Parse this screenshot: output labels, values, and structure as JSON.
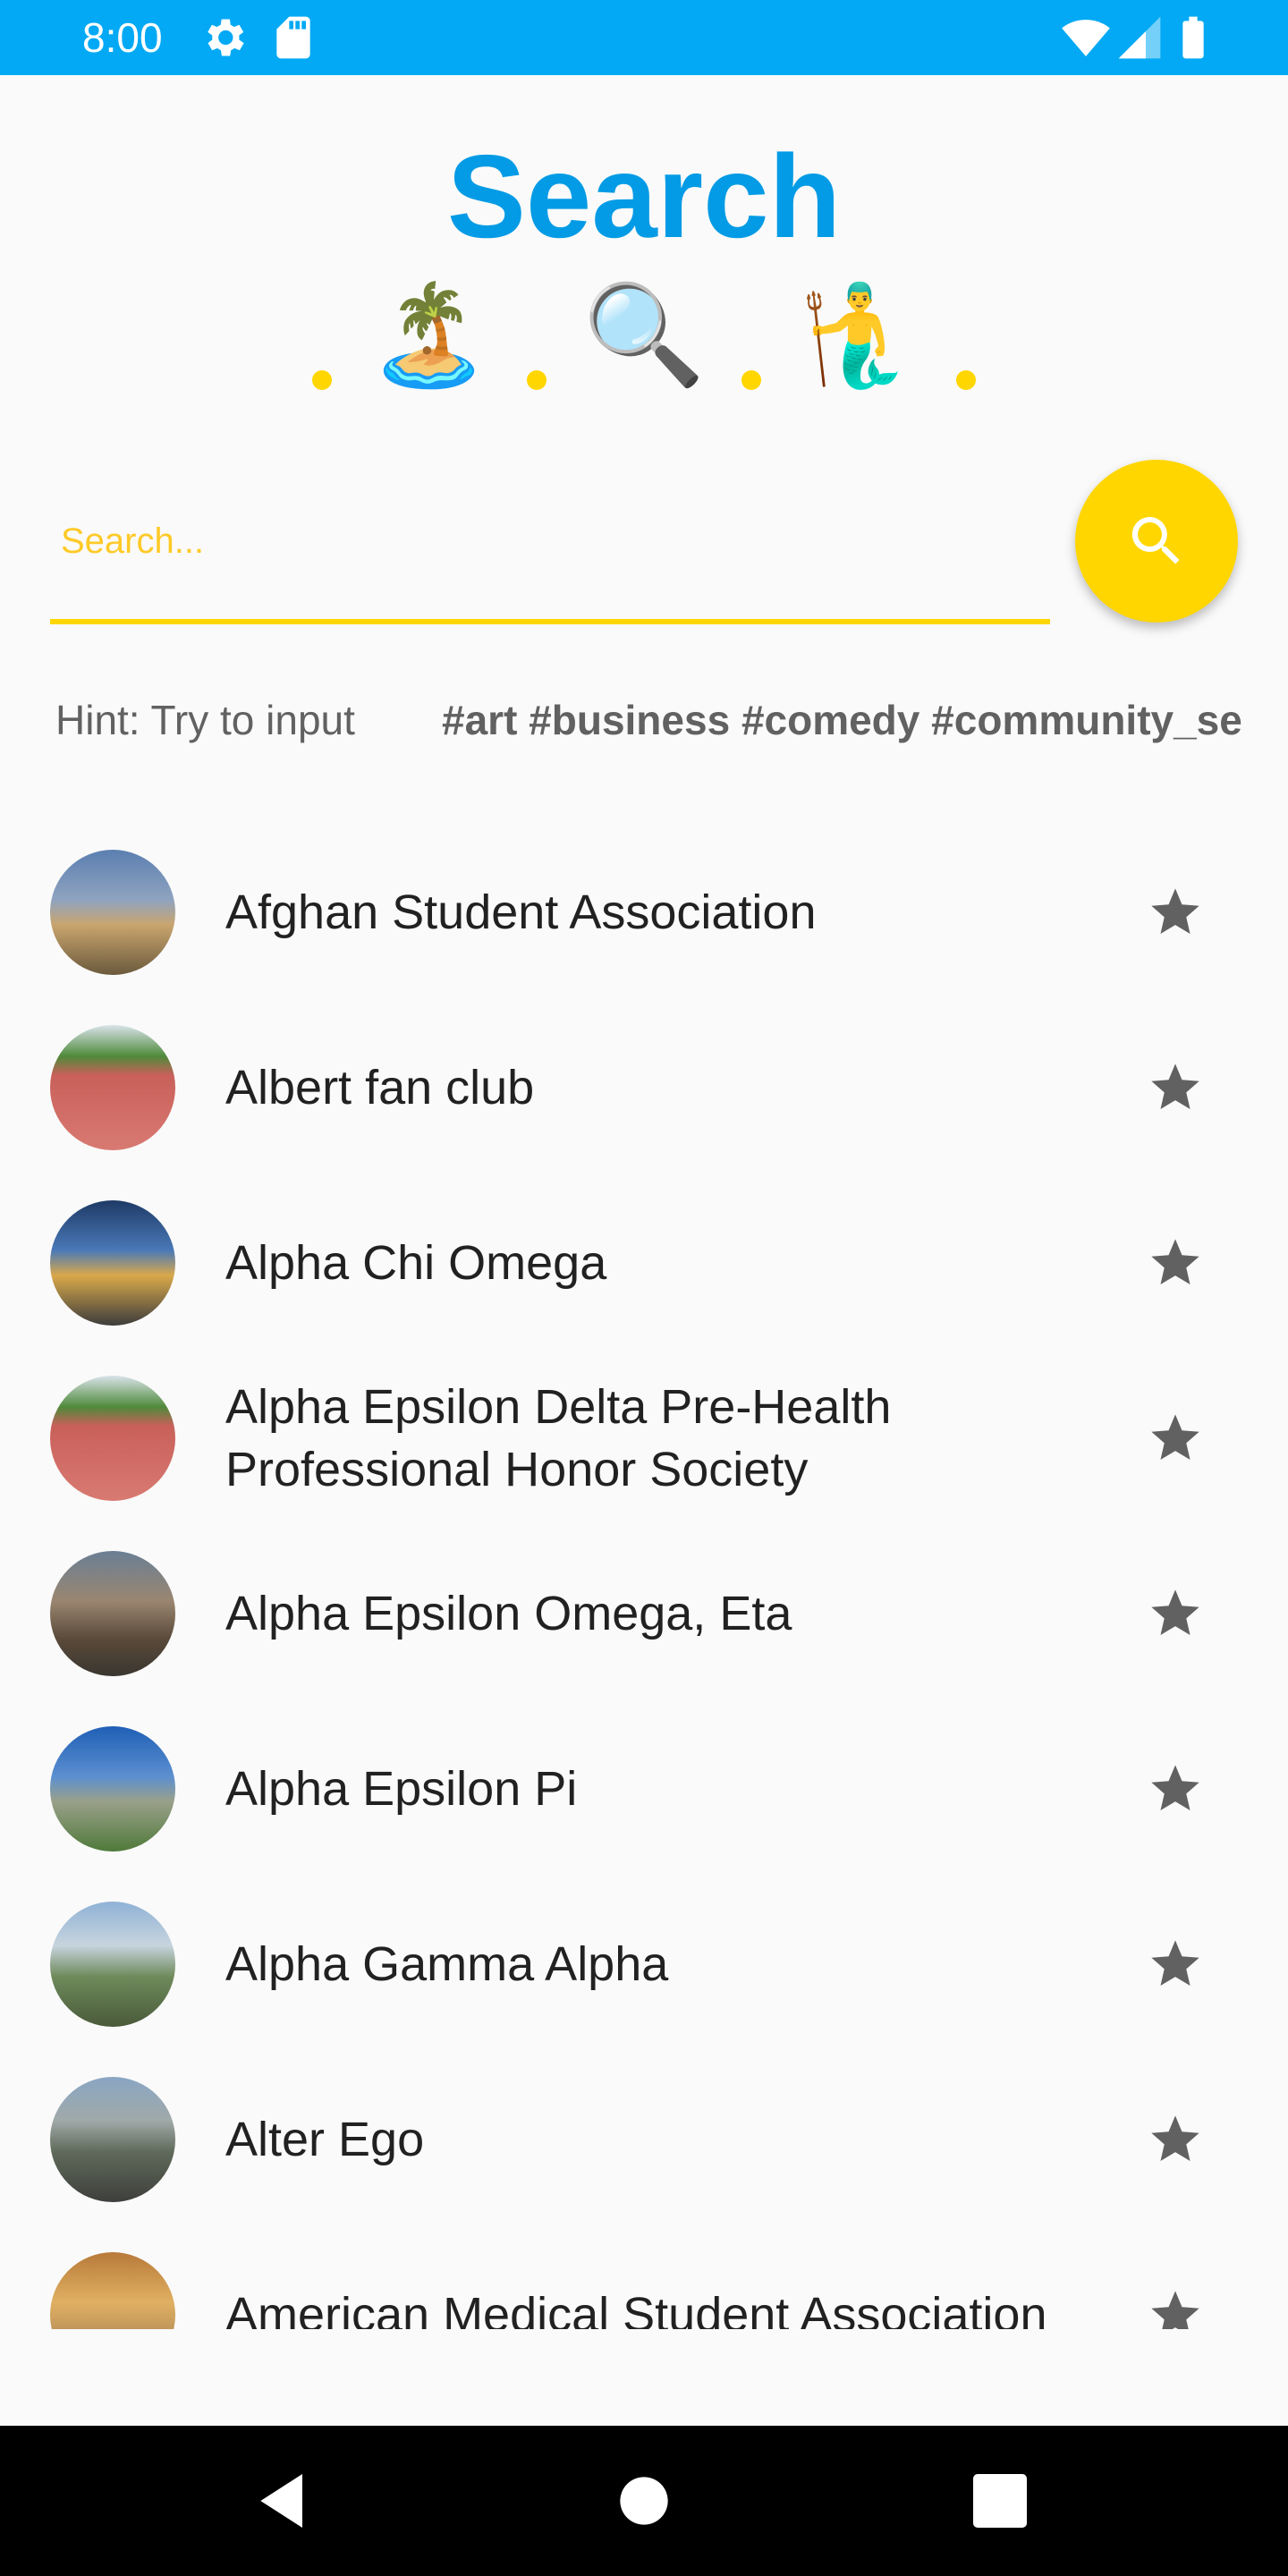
{
  "status_bar": {
    "time": "8:00",
    "icons": [
      "gear-icon",
      "sd-card-icon",
      "wifi-icon",
      "signal-icon",
      "battery-icon"
    ]
  },
  "header": {
    "title": "Search",
    "emojis": [
      "🏝️",
      "🔍",
      "🧜‍♂️"
    ]
  },
  "search": {
    "placeholder": "Search...",
    "value": ""
  },
  "hint": {
    "prefix": "Hint: Try to input",
    "tags": "#art #business #comedy #community_se"
  },
  "items": [
    {
      "name": "Afghan Student Association"
    },
    {
      "name": "Albert fan club"
    },
    {
      "name": "Alpha Chi Omega"
    },
    {
      "name": "Alpha Epsilon Delta Pre-Health Professional Honor Society"
    },
    {
      "name": "Alpha Epsilon Omega, Eta"
    },
    {
      "name": "Alpha Epsilon Pi"
    },
    {
      "name": "Alpha Gamma Alpha"
    },
    {
      "name": "Alter Ego"
    },
    {
      "name": "American Medical Student Association"
    }
  ],
  "colors": {
    "status_bar": "#03a9f4",
    "title": "#039be5",
    "accent": "#ffd600",
    "star": "#616161"
  }
}
